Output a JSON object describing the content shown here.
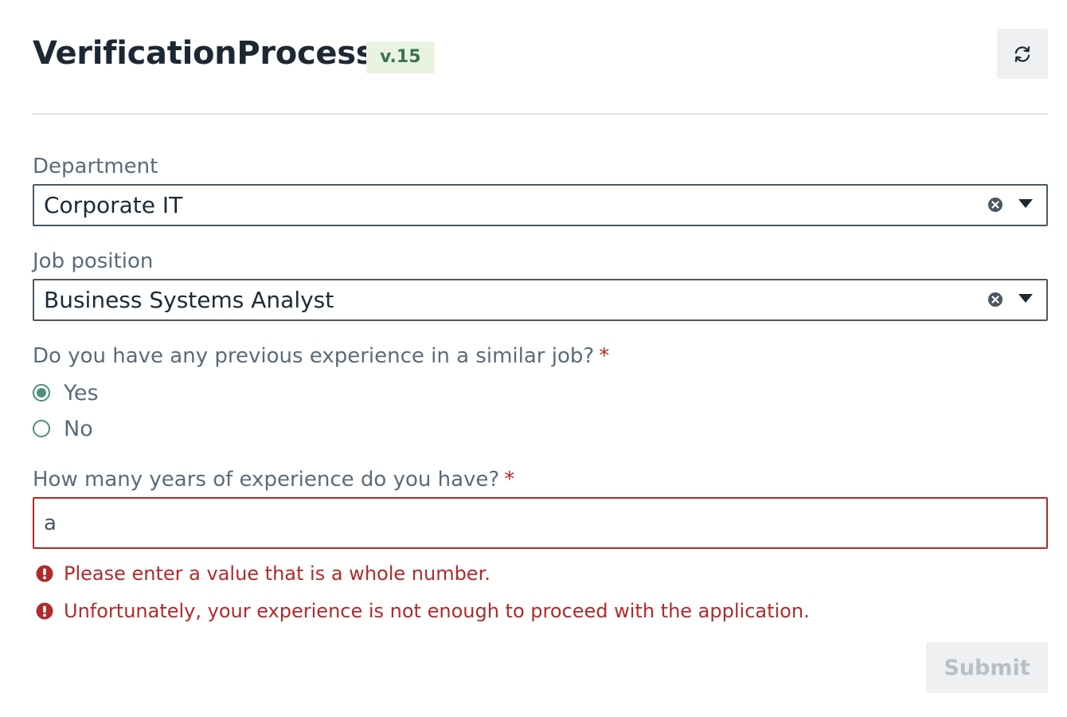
{
  "header": {
    "title": "VerificationProcess",
    "version": "v.15",
    "refresh_icon": "refresh-icon"
  },
  "form": {
    "department": {
      "label": "Department",
      "value": "Corporate IT",
      "clear_icon": "clear-icon",
      "dropdown_icon": "chevron-down-icon"
    },
    "job_position": {
      "label": "Job position",
      "value": "Business Systems Analyst",
      "clear_icon": "clear-icon",
      "dropdown_icon": "chevron-down-icon"
    },
    "experience_question": {
      "label": "Do you have any previous experience in a similar job?",
      "required_mark": "*",
      "options": [
        {
          "label": "Yes",
          "selected": true
        },
        {
          "label": "No",
          "selected": false
        }
      ]
    },
    "years_question": {
      "label": "How many years of experience do you have?",
      "required_mark": "*",
      "value": "a"
    },
    "errors": [
      "Please enter a value that is a whole number.",
      "Unfortunately, your experience is not enough to proceed with the application."
    ],
    "submit_label": "Submit"
  },
  "colors": {
    "accent": "#4f8f78",
    "error": "#b12a2a",
    "version_badge_bg": "#e8f4e1",
    "version_badge_text": "#3c7250"
  }
}
